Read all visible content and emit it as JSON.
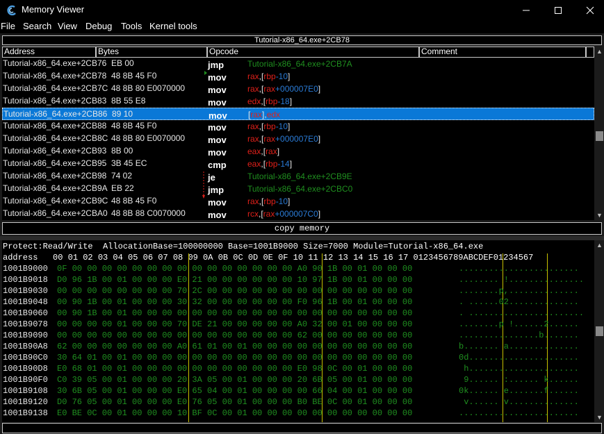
{
  "window": {
    "title": "Memory Viewer",
    "icon": "cheat-engine-icon",
    "controls": [
      "minimize-icon",
      "maximize-icon",
      "close-icon"
    ]
  },
  "menu": [
    "File",
    "Search",
    "View",
    "Debug",
    "Tools",
    "Kernel tools"
  ],
  "address_bar": "Tutorial-x86_64.exe+2CB78",
  "disassembler": {
    "columns": [
      "Address",
      "Bytes",
      "Opcode",
      "Comment"
    ],
    "rows": [
      {
        "address": "Tutorial-x86_64.exe+2CB76",
        "bytes": "EB 00",
        "opcode": "jmp",
        "args": [
          {
            "t": "Tutorial-x86_64.exe+2CB7A",
            "k": "jmp"
          }
        ]
      },
      {
        "address": "Tutorial-x86_64.exe+2CB78",
        "bytes": "48 8B 45 F0",
        "opcode": "mov",
        "args": [
          {
            "t": "rax",
            "k": "reg"
          },
          {
            "t": ",[",
            "k": "sep"
          },
          {
            "t": "rbp",
            "k": "reg"
          },
          {
            "t": "-10",
            "k": "num"
          },
          {
            "t": "]",
            "k": "sep"
          }
        ]
      },
      {
        "address": "Tutorial-x86_64.exe+2CB7C",
        "bytes": "48 8B 80 E0070000",
        "opcode": "mov",
        "args": [
          {
            "t": "rax",
            "k": "reg"
          },
          {
            "t": ",[",
            "k": "sep"
          },
          {
            "t": "rax",
            "k": "reg"
          },
          {
            "t": "+000007E0",
            "k": "num"
          },
          {
            "t": "]",
            "k": "sep"
          }
        ]
      },
      {
        "address": "Tutorial-x86_64.exe+2CB83",
        "bytes": "8B 55 E8",
        "opcode": "mov",
        "args": [
          {
            "t": "edx",
            "k": "reg"
          },
          {
            "t": ",[",
            "k": "sep"
          },
          {
            "t": "rbp",
            "k": "reg"
          },
          {
            "t": "-18",
            "k": "num"
          },
          {
            "t": "]",
            "k": "sep"
          }
        ]
      },
      {
        "address": "Tutorial-x86_64.exe+2CB86",
        "bytes": "89 10",
        "opcode": "mov",
        "selected": true,
        "args": [
          {
            "t": "[",
            "k": "sep"
          },
          {
            "t": "rax",
            "k": "reg"
          },
          {
            "t": "],",
            "k": "sep"
          },
          {
            "t": "edx",
            "k": "reg"
          }
        ]
      },
      {
        "address": "Tutorial-x86_64.exe+2CB88",
        "bytes": "48 8B 45 F0",
        "opcode": "mov",
        "args": [
          {
            "t": "rax",
            "k": "reg"
          },
          {
            "t": ",[",
            "k": "sep"
          },
          {
            "t": "rbp",
            "k": "reg"
          },
          {
            "t": "-10",
            "k": "num"
          },
          {
            "t": "]",
            "k": "sep"
          }
        ]
      },
      {
        "address": "Tutorial-x86_64.exe+2CB8C",
        "bytes": "48 8B 80 E0070000",
        "opcode": "mov",
        "args": [
          {
            "t": "rax",
            "k": "reg"
          },
          {
            "t": ",[",
            "k": "sep"
          },
          {
            "t": "rax",
            "k": "reg"
          },
          {
            "t": "+000007E0",
            "k": "num"
          },
          {
            "t": "]",
            "k": "sep"
          }
        ]
      },
      {
        "address": "Tutorial-x86_64.exe+2CB93",
        "bytes": "8B 00",
        "opcode": "mov",
        "args": [
          {
            "t": "eax",
            "k": "reg"
          },
          {
            "t": ",[",
            "k": "sep"
          },
          {
            "t": "rax",
            "k": "reg"
          },
          {
            "t": "]",
            "k": "sep"
          }
        ]
      },
      {
        "address": "Tutorial-x86_64.exe+2CB95",
        "bytes": "3B 45 EC",
        "opcode": "cmp",
        "args": [
          {
            "t": "eax",
            "k": "reg"
          },
          {
            "t": ",[",
            "k": "sep"
          },
          {
            "t": "rbp",
            "k": "reg"
          },
          {
            "t": "-14",
            "k": "num"
          },
          {
            "t": "]",
            "k": "sep"
          }
        ]
      },
      {
        "address": "Tutorial-x86_64.exe+2CB98",
        "bytes": "74 02",
        "opcode": "je",
        "args": [
          {
            "t": "Tutorial-x86_64.exe+2CB9E",
            "k": "jmp"
          }
        ]
      },
      {
        "address": "Tutorial-x86_64.exe+2CB9A",
        "bytes": "EB 22",
        "opcode": "jmp",
        "args": [
          {
            "t": "Tutorial-x86_64.exe+2CBC0",
            "k": "jmp"
          }
        ]
      },
      {
        "address": "Tutorial-x86_64.exe+2CB9C",
        "bytes": "48 8B 45 F0",
        "opcode": "mov",
        "args": [
          {
            "t": "rax",
            "k": "reg"
          },
          {
            "t": ",[",
            "k": "sep"
          },
          {
            "t": "rbp",
            "k": "reg"
          },
          {
            "t": "-10",
            "k": "num"
          },
          {
            "t": "]",
            "k": "sep"
          }
        ]
      },
      {
        "address": "Tutorial-x86_64.exe+2CBA0",
        "bytes": "48 8B 88 C0070000",
        "opcode": "mov",
        "args": [
          {
            "t": "rcx",
            "k": "reg"
          },
          {
            "t": ",[",
            "k": "sep"
          },
          {
            "t": "rax",
            "k": "reg"
          },
          {
            "t": "+000007C0",
            "k": "num"
          },
          {
            "t": "]",
            "k": "sep"
          }
        ]
      }
    ]
  },
  "copy_memory_label": "copy memory",
  "hexview": {
    "info": "Protect:Read/Write  AllocationBase=100000000 Base=1001B9000 Size=7000 Module=Tutorial-x86_64.exe",
    "header": "address   00 01 02 03 04 05 06 07 08 09 0A 0B 0C 0D 0E 0F 10 11 12 13 14 15 16 17 0123456789ABCDEF01234567",
    "rows": [
      {
        "address": "1001B9000",
        "bytes": "0F 00 00 00 00 00 00 00 00 00 00 00 00 00 00 00 A0 90 1B 00 01 00 00 00",
        "ascii": "........................"
      },
      {
        "address": "1001B9018",
        "bytes": "D0 96 1B 00 01 00 00 00 E0 21 00 00 00 00 00 00 10 97 1B 00 01 00 00 00",
        "ascii": "........ !..............."
      },
      {
        "address": "1001B9030",
        "bytes": "00 00 00 00 00 00 00 00 70 2C 00 00 00 00 00 00 00 00 00 00 00 00 00 00",
        "ascii": "........p,.............."
      },
      {
        "address": "1001B9048",
        "bytes": "00 90 1B 00 01 00 00 00 30 32 00 00 00 00 00 00 F0 96 1B 00 01 00 00 00",
        "ascii": ". ......02.............."
      },
      {
        "address": "1001B9060",
        "bytes": "00 90 1B 00 01 00 00 00 00 00 00 00 00 00 00 00 00 00 00 00 00 00 00 00",
        "ascii": ". ......................."
      },
      {
        "address": "1001B9078",
        "bytes": "00 00 00 00 01 00 00 00 70 DE 21 00 00 00 00 00 A0 32 00 01 00 00 00 00",
        "ascii": "........p !......2......"
      },
      {
        "address": "1001B9090",
        "bytes": "00 00 00 00 00 00 00 00 00 00 00 00 00 00 00 00 62 00 00 00 00 00 00 00",
        "ascii": "................b......."
      },
      {
        "address": "1001B90A8",
        "bytes": "62 00 00 00 00 00 00 00 A0 61 01 00 01 00 00 00 00 00 00 00 00 00 00 00",
        "ascii": "b....... a.............."
      },
      {
        "address": "1001B90C0",
        "bytes": "30 64 01 00 01 00 00 00 00 00 00 00 00 00 00 00 00 00 00 00 00 00 00 00",
        "ascii": "0d......................"
      },
      {
        "address": "1001B90D8",
        "bytes": "E0 68 01 00 01 00 00 00 00 00 00 00 00 00 00 00 E0 98 0C 00 01 00 00 00",
        "ascii": " h......................"
      },
      {
        "address": "1001B90F0",
        "bytes": "C0 39 05 00 01 00 00 00 20 3A 05 00 01 00 00 00 20 6B 05 00 01 00 00 00",
        "ascii": " 9...... :...... k......"
      },
      {
        "address": "1001B9108",
        "bytes": "30 6B 05 00 01 00 00 00 E0 65 04 00 01 00 00 00 00 66 04 00 01 00 00 00",
        "ascii": "0k...... e.......f......"
      },
      {
        "address": "1001B9120",
        "bytes": "D0 76 05 00 01 00 00 00 E0 76 05 00 01 00 00 00 B0 BE 0C 00 01 00 00 00",
        "ascii": " v...... v.............."
      },
      {
        "address": "1001B9138",
        "bytes": "E0 BE 0C 00 01 00 00 00 10 BF 0C 00 01 00 00 00 00 00 00 00 00 00 00 00",
        "ascii": "........................"
      }
    ]
  },
  "colors": {
    "register": "#e0201a",
    "number": "#2a7bd6",
    "jump_target": "#1f8f1f",
    "selection": "#0a78d7",
    "hex_bytes": "#1f8f1f",
    "column_separator": "#c9c200"
  }
}
